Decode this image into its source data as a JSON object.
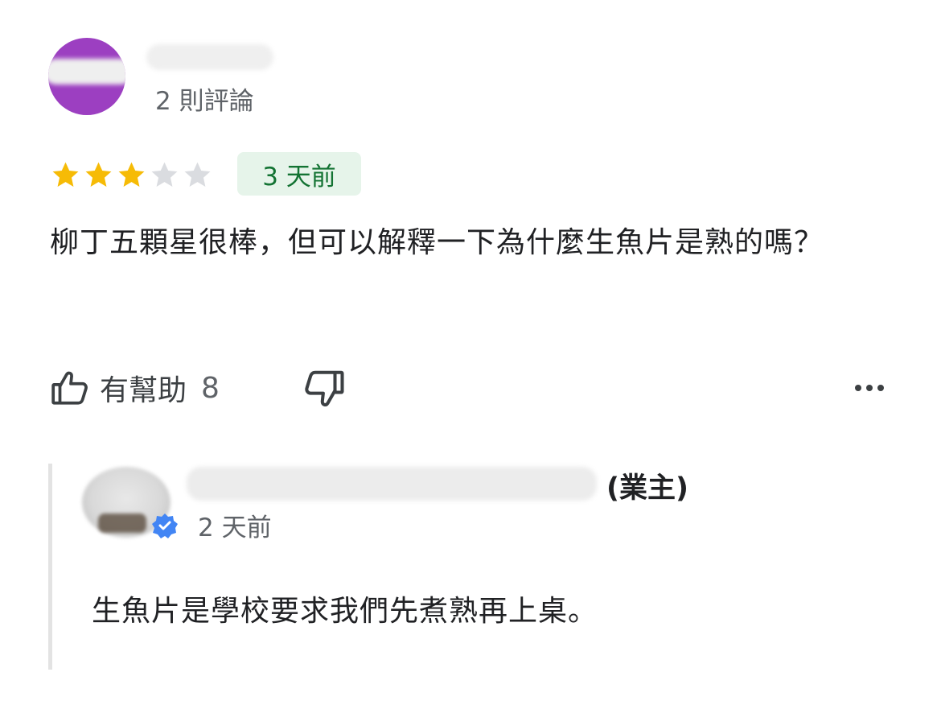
{
  "reviewer": {
    "name": "",
    "review_count": "2 則評論",
    "avatar_color": "#9c3fc1"
  },
  "rating": {
    "value": 3,
    "max": 5,
    "filled_color": "#f6bb06",
    "empty_color": "#dadce0"
  },
  "time_badge": {
    "label": "3 天前",
    "bg_color": "#e6f4ea",
    "text_color": "#137333"
  },
  "review": {
    "text": "柳丁五顆星很棒，但可以解釋一下為什麼生魚片是熟的嗎？"
  },
  "actions": {
    "helpful_label": "有幫助",
    "helpful_count": "8",
    "icons": [
      "thumb-up-icon",
      "thumb-down-icon",
      "more-options-icon"
    ]
  },
  "owner_reply": {
    "name": "",
    "owner_tag": "(業主)",
    "time": "2 天前",
    "text": "生魚片是學校要求我們先煮熟再上桌。",
    "badge_color": "#4285f4"
  }
}
